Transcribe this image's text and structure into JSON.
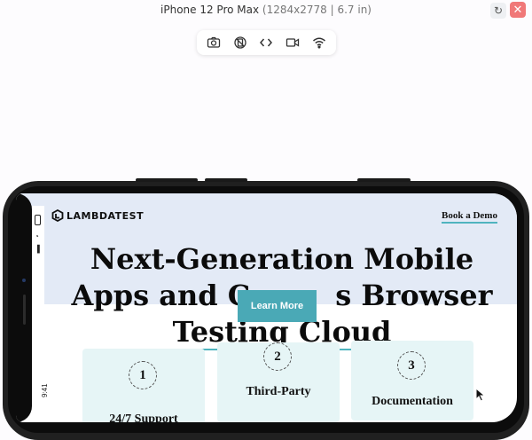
{
  "device_bar": {
    "device_name": "iPhone 12 Pro Max",
    "device_spec": "(1284x2778 | 6.7 in)",
    "rotate_icon": "rotate-icon",
    "close_icon": "close-icon"
  },
  "toolbar": {
    "items": [
      {
        "icon": "camera-icon"
      },
      {
        "icon": "no-rotate-icon"
      },
      {
        "icon": "code-icon"
      },
      {
        "icon": "video-icon"
      },
      {
        "icon": "wifi-icon"
      }
    ]
  },
  "status": {
    "time": "9:41"
  },
  "site": {
    "logo_text": "LAMBDATEST",
    "nav_cta": "Book a Demo",
    "hero_line1": "Next-Generation Mobile",
    "hero_line2a": "Apps and C",
    "hero_line2b": "s Browser",
    "hero_line3": "Testing Cloud",
    "learn_more": "Learn More",
    "cards": [
      {
        "number": "1",
        "label": "24/7 Support"
      },
      {
        "number": "2",
        "label": "Third-Party"
      },
      {
        "number": "3",
        "label": "Documentation"
      }
    ]
  },
  "colors": {
    "accent": "#4aa9b6",
    "hero_bg": "#e3eaf6",
    "card_bg": "#e6f5f6",
    "close": "#f07878"
  }
}
